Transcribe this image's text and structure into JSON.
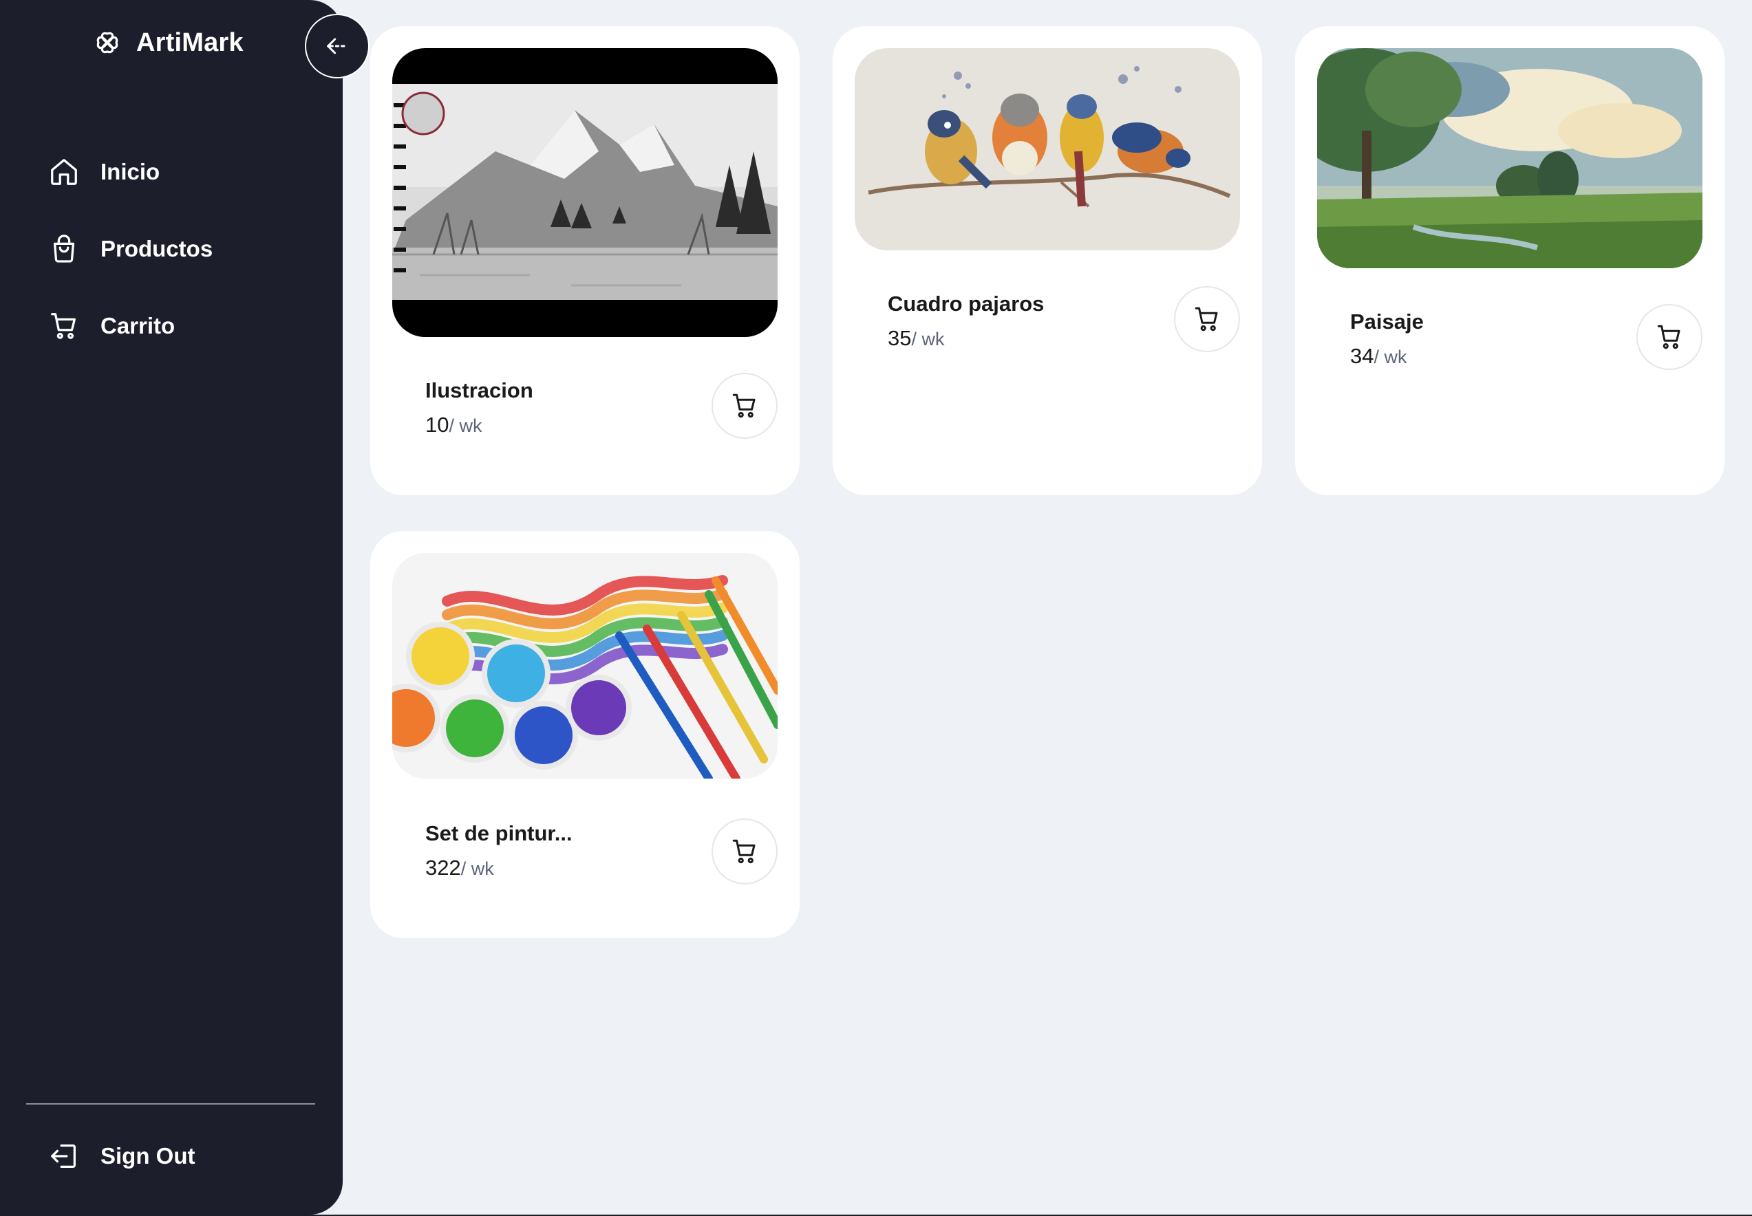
{
  "brand": {
    "name": "ArtiMark",
    "logo_icon": "clover-logo-icon"
  },
  "sidebar": {
    "collapse_icon": "arrow-left-icon",
    "items": [
      {
        "label": "Inicio",
        "icon": "home-icon"
      },
      {
        "label": "Productos",
        "icon": "shopping-bag-icon"
      },
      {
        "label": "Carrito",
        "icon": "cart-icon"
      }
    ],
    "signout": {
      "label": "Sign Out",
      "icon": "logout-icon"
    }
  },
  "products": [
    {
      "title": "Ilustracion",
      "price": "10",
      "unit": "/ wk",
      "image": "pencil mountain landscape sketch"
    },
    {
      "title": "Cuadro pajaros",
      "price": "35",
      "unit": "/ wk",
      "image": "watercolor birds on branch"
    },
    {
      "title": "Paisaje",
      "price": "34",
      "unit": "/ wk",
      "image": "watercolor landscape with trees"
    },
    {
      "title": "Set de pintur...",
      "price": "322",
      "unit": "/ wk",
      "image": "paint pots and brushes with rainbow strokes"
    }
  ],
  "colors": {
    "sidebar_bg": "#1c1f2b",
    "page_bg": "#eef1f5",
    "card_bg": "#ffffff",
    "unit_text": "#5b6478"
  }
}
